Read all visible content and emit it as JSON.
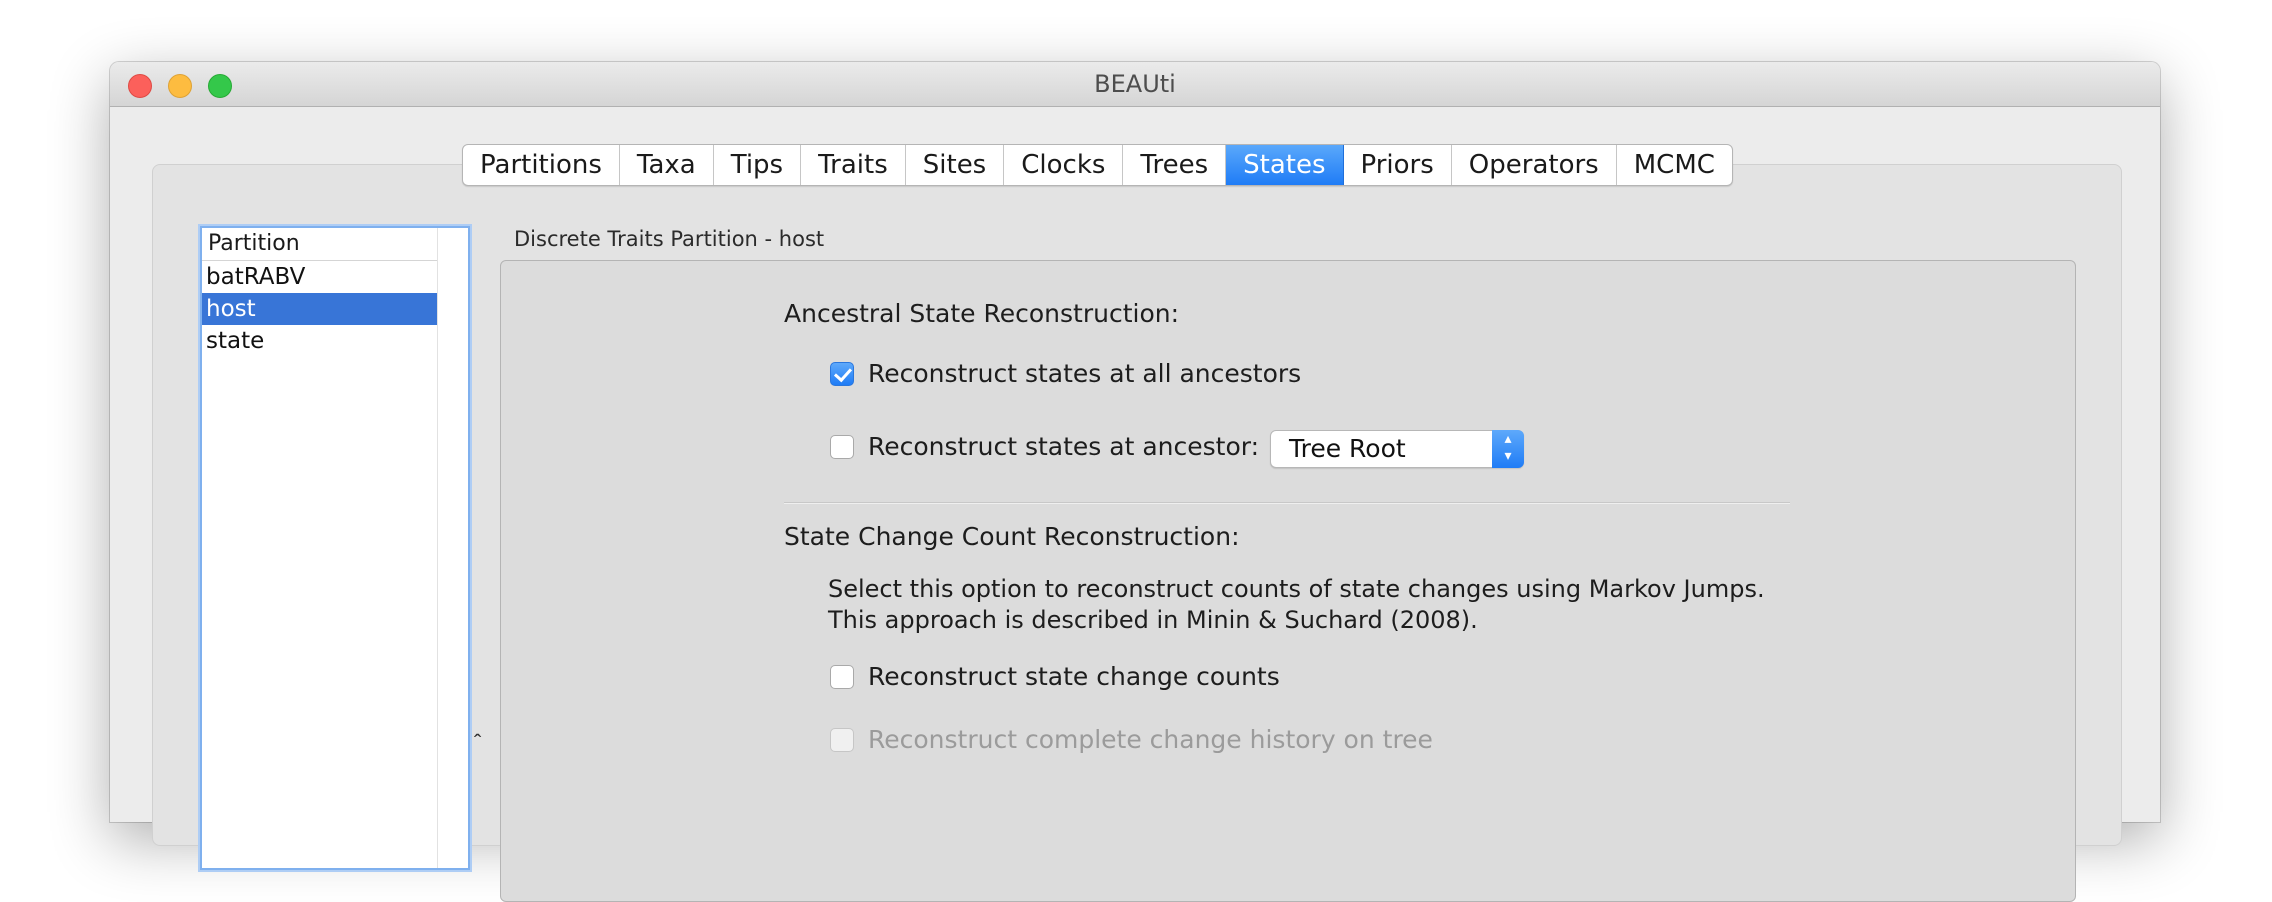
{
  "window": {
    "title": "BEAUti"
  },
  "tabs": [
    {
      "label": "Partitions",
      "active": false
    },
    {
      "label": "Taxa",
      "active": false
    },
    {
      "label": "Tips",
      "active": false
    },
    {
      "label": "Traits",
      "active": false
    },
    {
      "label": "Sites",
      "active": false
    },
    {
      "label": "Clocks",
      "active": false
    },
    {
      "label": "Trees",
      "active": false
    },
    {
      "label": "States",
      "active": true
    },
    {
      "label": "Priors",
      "active": false
    },
    {
      "label": "Operators",
      "active": false
    },
    {
      "label": "MCMC",
      "active": false
    }
  ],
  "partition_list": {
    "header": "Partition",
    "items": [
      {
        "label": "batRABV",
        "selected": false
      },
      {
        "label": "host",
        "selected": true
      },
      {
        "label": "state",
        "selected": false
      }
    ]
  },
  "panel": {
    "title": "Discrete Traits Partition - host",
    "ancestral_heading": "Ancestral State Reconstruction:",
    "reconstruct_all": {
      "label": "Reconstruct states at all ancestors",
      "checked": true
    },
    "reconstruct_at": {
      "label": "Reconstruct states at ancestor:",
      "checked": false
    },
    "ancestor_select": {
      "value": "Tree Root"
    },
    "count_heading": "State Change Count Reconstruction:",
    "count_description": "Select this option to reconstruct counts of state changes using Markov Jumps. This approach is described in Minin & Suchard (2008).",
    "reconstruct_counts": {
      "label": "Reconstruct state change counts",
      "checked": false
    },
    "reconstruct_history": {
      "label": "Reconstruct complete change history on tree",
      "checked": false,
      "disabled": true
    }
  },
  "colors": {
    "accent": "#1f7cf6",
    "selection": "#3875d7"
  }
}
